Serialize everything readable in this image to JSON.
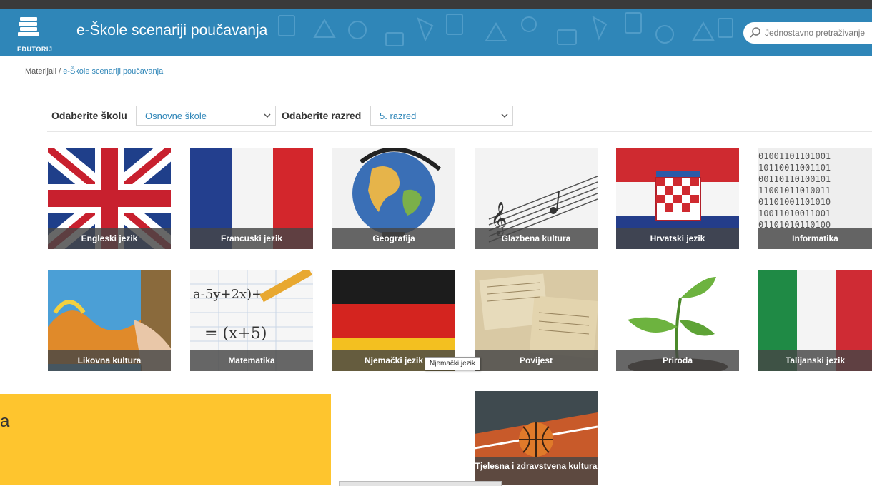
{
  "header": {
    "logo_text": "EDUTORIJ",
    "title": "e-Škole scenariji poučavanja",
    "search_placeholder": "Jednostavno pretraživanje"
  },
  "breadcrumb": {
    "root": "Materijali",
    "separator": " / ",
    "current": "e-Škole scenariji poučavanja"
  },
  "filters": {
    "school_label": "Odaberite školu",
    "school_value": "Osnovne škole",
    "grade_label": "Odaberite razred",
    "grade_value": "5. razred"
  },
  "subjects": [
    "Engleski jezik",
    "Francuski jezik",
    "Geografija",
    "Glazbena kultura",
    "Hrvatski jezik",
    "Informatika",
    "Likovna kultura",
    "Matematika",
    "Njemački jezik",
    "Povijest",
    "Priroda",
    "Talijanski jezik",
    "Tjelesna i zdravstvena kultura"
  ],
  "tooltip": "Njemački jezik",
  "overlay_text": "a",
  "colors": {
    "header": "#2f86b8",
    "accent_link": "#2f86b8",
    "tile_label_bg": "#464646",
    "overlay_yellow": "#fec52e"
  }
}
